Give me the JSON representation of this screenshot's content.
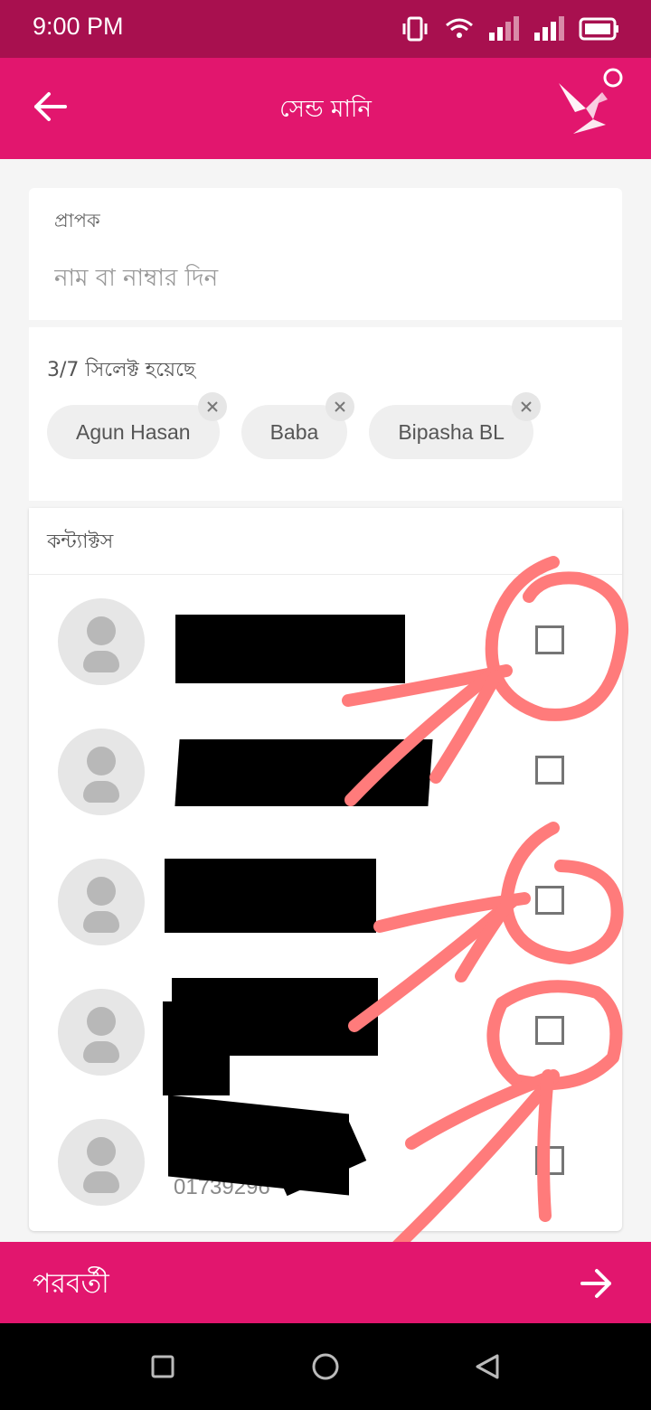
{
  "status_bar": {
    "time": "9:00 PM"
  },
  "app_bar": {
    "title": "সেন্ড মানি"
  },
  "recipient": {
    "label": "প্রাপক",
    "placeholder": "নাম বা নাম্বার দিন"
  },
  "selected": {
    "label": "3/7 সিলেক্ট হয়েছে",
    "chips": [
      "Agun Hasan",
      "Baba",
      "Bipasha BL"
    ]
  },
  "contacts": {
    "label": "কন্ট্যাক্টস",
    "items": [
      {
        "checked": false
      },
      {
        "checked": false
      },
      {
        "checked": false
      },
      {
        "checked": false
      },
      {
        "number_partial": "01739296"
      }
    ]
  },
  "footer": {
    "next_label": "পরবর্তী"
  },
  "colors": {
    "primary": "#e2166e",
    "status_bar": "#a8104f",
    "annotation": "#ff7b7b"
  }
}
